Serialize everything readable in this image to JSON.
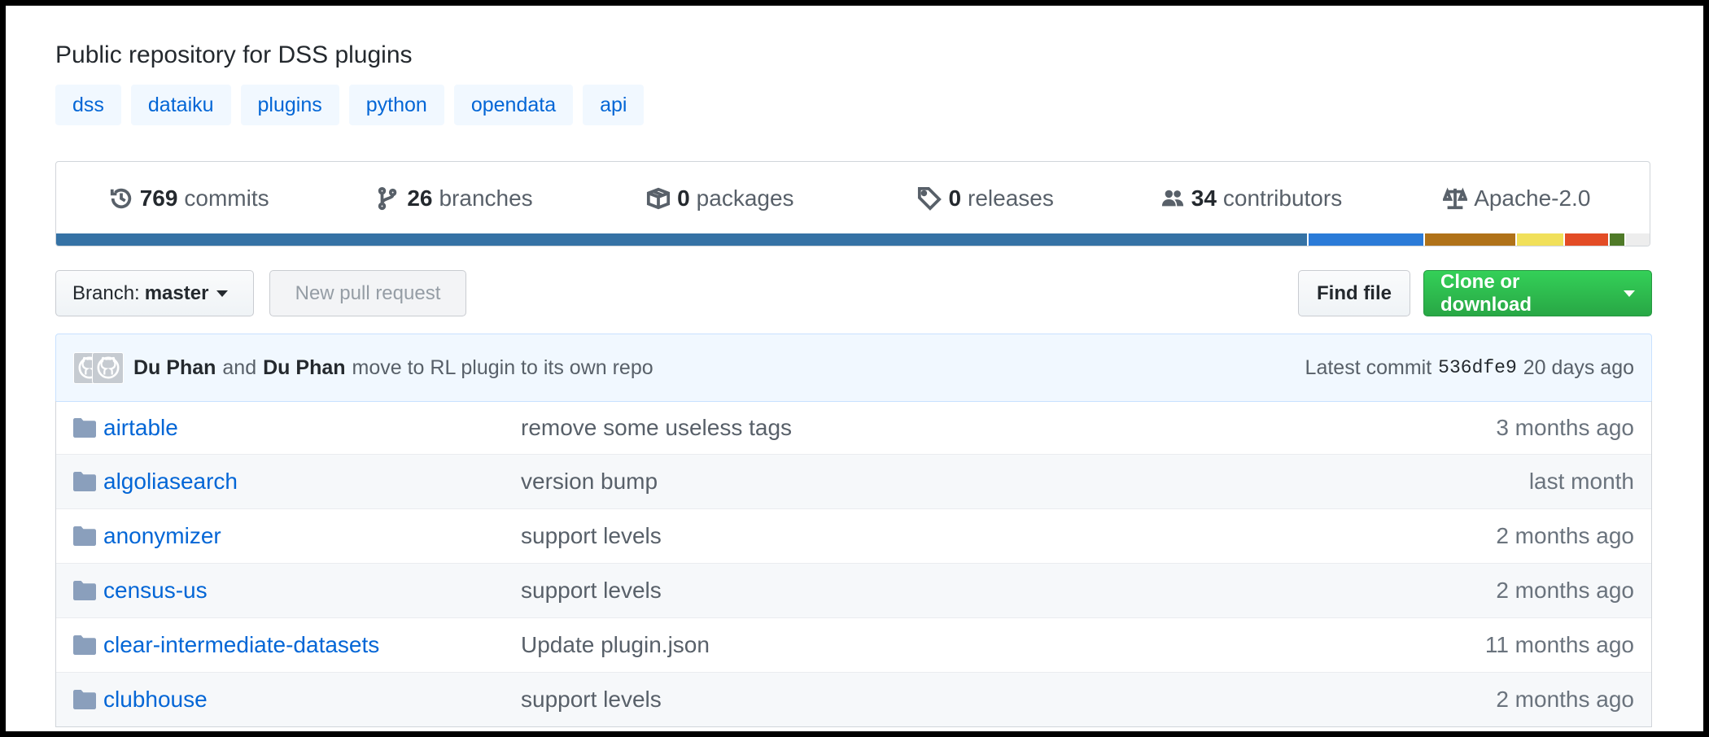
{
  "repo": {
    "description": "Public repository for DSS plugins",
    "topics": [
      "dss",
      "dataiku",
      "plugins",
      "python",
      "opendata",
      "api"
    ]
  },
  "summary": {
    "commits": {
      "count": "769",
      "label": "commits"
    },
    "branches": {
      "count": "26",
      "label": "branches"
    },
    "packages": {
      "count": "0",
      "label": "packages"
    },
    "releases": {
      "count": "0",
      "label": "releases"
    },
    "contributors": {
      "count": "34",
      "label": "contributors"
    },
    "license": "Apache-2.0"
  },
  "languages": [
    {
      "color": "#3572A5",
      "percent": 78.6
    },
    {
      "color": "#2b7bd8",
      "percent": 7.3
    },
    {
      "color": "#b07219",
      "percent": 5.8
    },
    {
      "color": "#f1e05a",
      "percent": 3.0
    },
    {
      "color": "#e34c26",
      "percent": 2.8
    },
    {
      "color": "#4F7A28",
      "percent": 1.0
    },
    {
      "color": "#ededed",
      "percent": 1.5
    }
  ],
  "toolbar": {
    "branch_prefix": "Branch:",
    "branch_name": "master",
    "new_pr": "New pull request",
    "find_file": "Find file",
    "clone": "Clone or download"
  },
  "latest_commit": {
    "author1": "Du Phan",
    "joiner": "and",
    "author2": "Du Phan",
    "message": "move to RL plugin to its own repo",
    "prefix": "Latest commit",
    "sha": "536dfe9",
    "age": "20 days ago"
  },
  "files": [
    {
      "name": "airtable",
      "message": "remove some useless tags",
      "age": "3 months ago"
    },
    {
      "name": "algoliasearch",
      "message": "version bump",
      "age": "last month"
    },
    {
      "name": "anonymizer",
      "message": "support levels",
      "age": "2 months ago"
    },
    {
      "name": "census-us",
      "message": "support levels",
      "age": "2 months ago"
    },
    {
      "name": "clear-intermediate-datasets",
      "message": "Update plugin.json",
      "age": "11 months ago"
    },
    {
      "name": "clubhouse",
      "message": "support levels",
      "age": "2 months ago"
    }
  ],
  "icons": {
    "commits": "history-icon",
    "branches": "git-branch-icon",
    "packages": "package-icon",
    "releases": "tag-icon",
    "contributors": "people-icon",
    "license": "law-icon",
    "folder": "folder-icon"
  },
  "colors": {
    "link": "#0366d6",
    "clone_green": "#28a745",
    "commit_bar_bg": "#f1f8ff"
  }
}
